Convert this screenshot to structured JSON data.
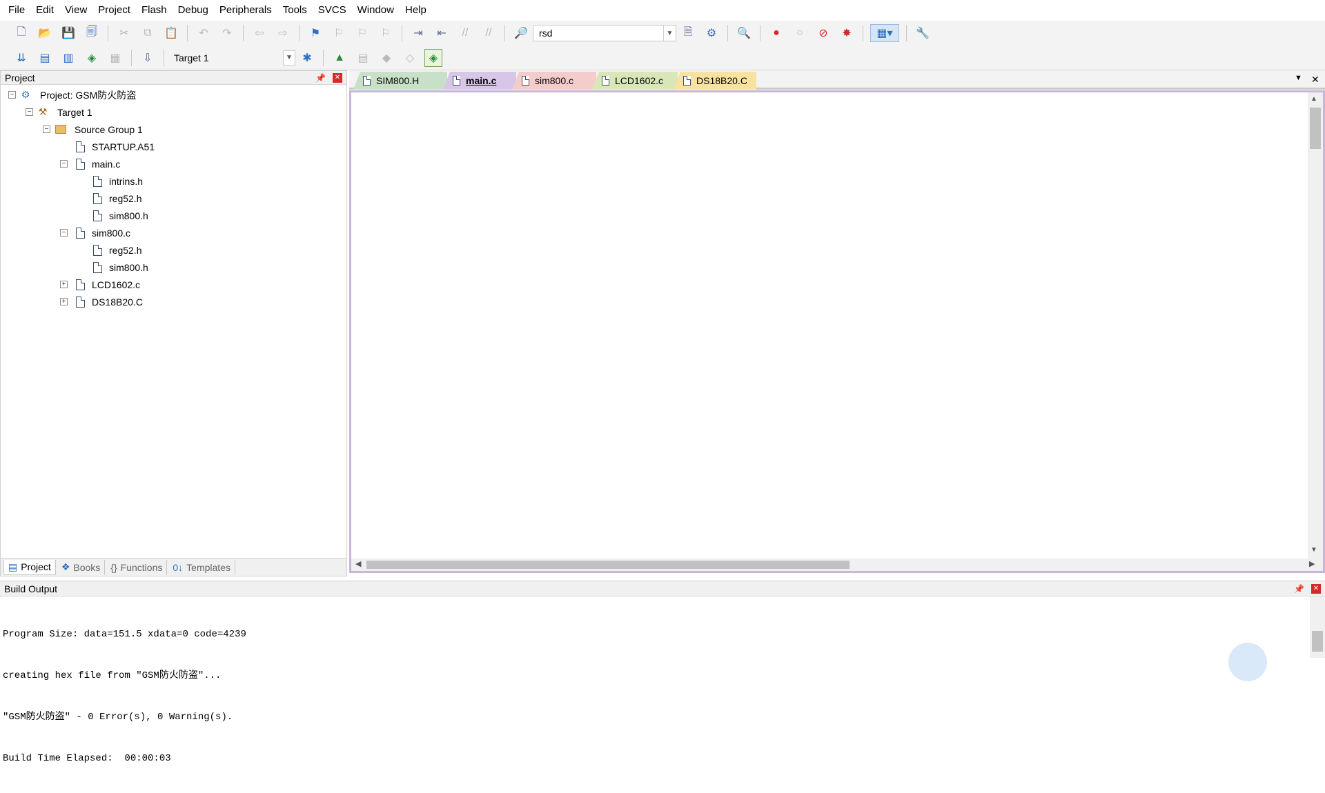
{
  "menu": [
    "File",
    "Edit",
    "View",
    "Project",
    "Flash",
    "Debug",
    "Peripherals",
    "Tools",
    "SVCS",
    "Window",
    "Help"
  ],
  "toolbar": {
    "find_combo_value": "rsd",
    "target_combo_value": "Target 1"
  },
  "project_panel": {
    "title": "Project",
    "tree": {
      "project": "Project: GSM防火防盗",
      "target": "Target 1",
      "group": "Source Group 1",
      "files": {
        "startup": "STARTUP.A51",
        "main": "main.c",
        "main_intrins": "intrins.h",
        "main_reg52": "reg52.h",
        "main_sim800": "sim800.h",
        "sim800c": "sim800.c",
        "sim800c_reg52": "reg52.h",
        "sim800c_sim800": "sim800.h",
        "lcd": "LCD1602.c",
        "ds": "DS18B20.C"
      }
    },
    "tabs": [
      "Project",
      "Books",
      "Functions",
      "Templates"
    ]
  },
  "editor": {
    "tabs": [
      "SIM800.H",
      "main.c",
      "sim800.c",
      "LCD1602.c",
      "DS18B20.C"
    ],
    "active_tab": "main.c",
    "tab_colors": [
      "#c7e0c7",
      "#d7c6e8",
      "#f5cccc",
      "#d8e6b8",
      "#f7e2a0"
    ]
  },
  "build_output": {
    "title": "Build Output",
    "lines": [
      "Program Size: data=151.5 xdata=0 code=4239",
      "creating hex file from \"GSM防火防盗\"...",
      "\"GSM防火防盗\" - 0 Error(s), 0 Warning(s).",
      "Build Time Elapsed:  00:00:03"
    ]
  }
}
